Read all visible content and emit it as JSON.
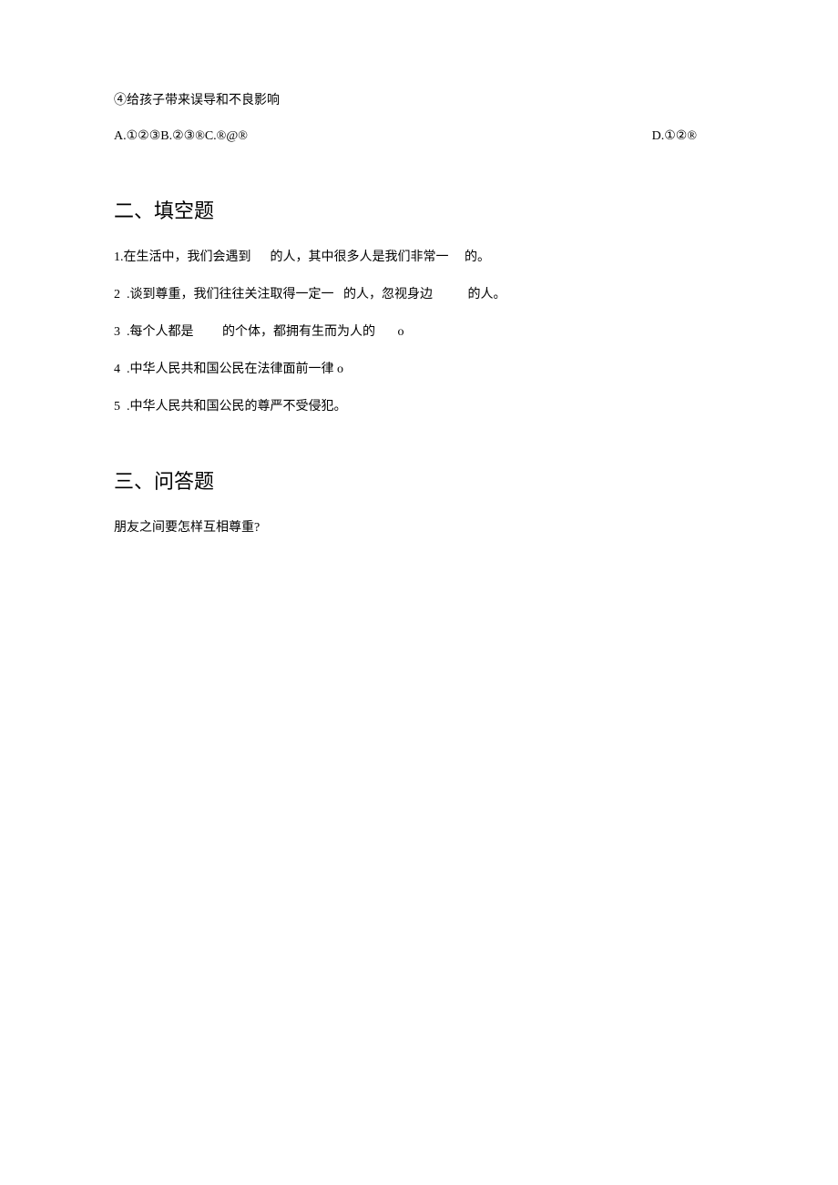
{
  "intro": {
    "statement4": "④给孩子带来误导和不良影响",
    "options_left": "A.①②③B.②③®C.®@®",
    "options_right": "D.①②®"
  },
  "section2": {
    "heading": "二、填空题",
    "q1": "1.在生活中，我们会遇到      的人，其中很多人是我们非常一     的。",
    "q2": "2  .谈到尊重，我们往往关注取得一定一   的人，忽视身边           的人。",
    "q3": "3  .每个人都是         的个体，都拥有生而为人的       o",
    "q4": "4  .中华人民共和国公民在法律面前一律 o",
    "q5": "5  .中华人民共和国公民的尊严不受侵犯。"
  },
  "section3": {
    "heading": "三、问答题",
    "q1": "朋友之间要怎样互相尊重?"
  }
}
